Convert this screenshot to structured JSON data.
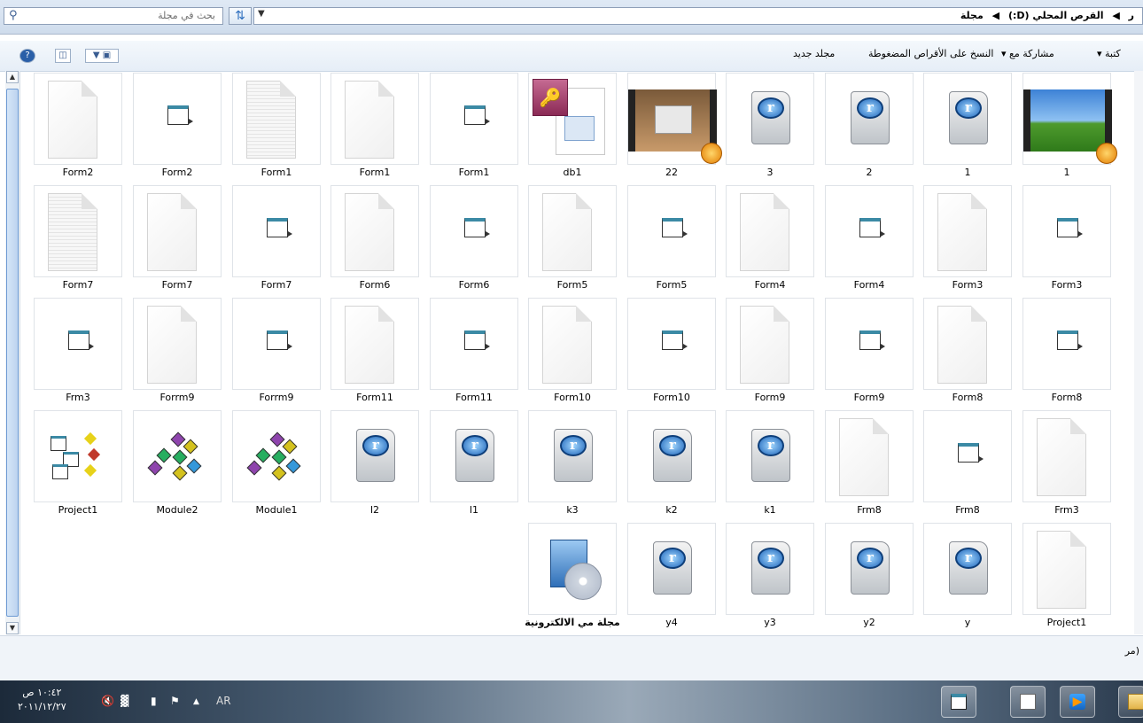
{
  "address_bar": {
    "search_placeholder": "بحث في مجلة",
    "crumbs": [
      "القرص المحلي (D:)",
      "مجلة"
    ],
    "crumb_prefix": "ر"
  },
  "toolbar": {
    "new_folder": "مجلد جديد",
    "burn": "النسخ على الأقراص المضغوطة",
    "share": "مشاركة مع ▾",
    "library": "كتبة ▾"
  },
  "files": [
    {
      "name": "1",
      "type": "video2"
    },
    {
      "name": "1",
      "type": "real"
    },
    {
      "name": "2",
      "type": "real"
    },
    {
      "name": "3",
      "type": "real"
    },
    {
      "name": "22",
      "type": "video1"
    },
    {
      "name": "db1",
      "type": "access"
    },
    {
      "name": "Form1",
      "type": "form"
    },
    {
      "name": "Form1",
      "type": "doc"
    },
    {
      "name": "Form1",
      "type": "lined"
    },
    {
      "name": "Form2",
      "type": "form"
    },
    {
      "name": "Form2",
      "type": "doc"
    },
    {
      "name": "Form3",
      "type": "form"
    },
    {
      "name": "Form3",
      "type": "doc"
    },
    {
      "name": "Form4",
      "type": "form"
    },
    {
      "name": "Form4",
      "type": "doc"
    },
    {
      "name": "Form5",
      "type": "form"
    },
    {
      "name": "Form5",
      "type": "doc"
    },
    {
      "name": "Form6",
      "type": "form"
    },
    {
      "name": "Form6",
      "type": "doc"
    },
    {
      "name": "Form7",
      "type": "form"
    },
    {
      "name": "Form7",
      "type": "doc"
    },
    {
      "name": "Form7",
      "type": "lined"
    },
    {
      "name": "Form8",
      "type": "form"
    },
    {
      "name": "Form8",
      "type": "doc"
    },
    {
      "name": "Form9",
      "type": "form"
    },
    {
      "name": "Form9",
      "type": "doc"
    },
    {
      "name": "Form10",
      "type": "form"
    },
    {
      "name": "Form10",
      "type": "doc"
    },
    {
      "name": "Form11",
      "type": "form"
    },
    {
      "name": "Form11",
      "type": "doc"
    },
    {
      "name": "Forrm9",
      "type": "form"
    },
    {
      "name": "Forrm9",
      "type": "doc"
    },
    {
      "name": "Frm3",
      "type": "form"
    },
    {
      "name": "Frm3",
      "type": "doc"
    },
    {
      "name": "Frm8",
      "type": "form"
    },
    {
      "name": "Frm8",
      "type": "doc"
    },
    {
      "name": "k1",
      "type": "real"
    },
    {
      "name": "k2",
      "type": "real"
    },
    {
      "name": "k3",
      "type": "real"
    },
    {
      "name": "l1",
      "type": "real"
    },
    {
      "name": "l2",
      "type": "real"
    },
    {
      "name": "Module1",
      "type": "module"
    },
    {
      "name": "Module2",
      "type": "module"
    },
    {
      "name": "Project1",
      "type": "project"
    },
    {
      "name": "Project1",
      "type": "doc"
    },
    {
      "name": "y",
      "type": "real"
    },
    {
      "name": "y2",
      "type": "real"
    },
    {
      "name": "y3",
      "type": "real"
    },
    {
      "name": "y4",
      "type": "real"
    },
    {
      "name": "مجلة مي الالكترونية",
      "type": "cd"
    }
  ],
  "status": {
    "text": "(مر"
  },
  "taskbar": {
    "time": "١٠:٤٢ ص",
    "date": "٢٠١١/١٢/٢٧",
    "lang": "AR"
  }
}
